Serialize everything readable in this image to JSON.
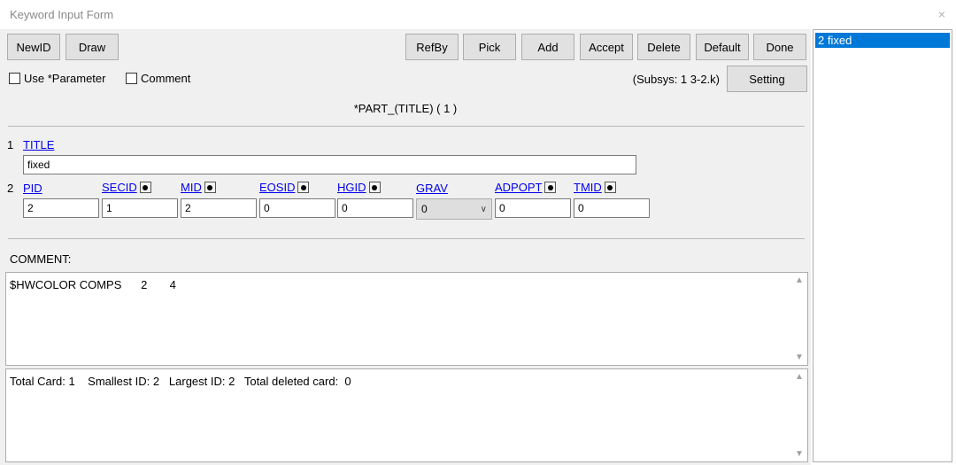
{
  "window": {
    "title": "Keyword Input Form",
    "close_glyph": "×"
  },
  "toolbar": {
    "newid": "NewID",
    "draw": "Draw",
    "refby": "RefBy",
    "pick": "Pick",
    "add": "Add",
    "accept": "Accept",
    "delete": "Delete",
    "default": "Default",
    "done": "Done",
    "setting": "Setting"
  },
  "options": {
    "use_parameter": "Use *Parameter",
    "comment": "Comment",
    "subsys": "(Subsys: 1 3-2.k)"
  },
  "keyword": {
    "title": "*PART_(TITLE)    ( 1 )"
  },
  "card1": {
    "num": "1",
    "title_label": "TITLE",
    "title_value": "fixed"
  },
  "card2": {
    "num": "2",
    "labels": {
      "pid": "PID",
      "secid": "SECID",
      "mid": "MID",
      "eosid": "EOSID",
      "hgid": "HGID",
      "grav": "GRAV",
      "adpopt": "ADPOPT",
      "tmid": "TMID"
    },
    "values": {
      "pid": "2",
      "secid": "1",
      "mid": "2",
      "eosid": "0",
      "hgid": "0",
      "grav": "0",
      "adpopt": "0",
      "tmid": "0"
    }
  },
  "comment": {
    "label": "COMMENT:",
    "text": "$HWCOLOR COMPS      2       4"
  },
  "status": {
    "text": "Total Card: 1    Smallest ID: 2   Largest ID: 2   Total deleted card:  0"
  },
  "list": {
    "items": [
      {
        "label": "2   fixed",
        "selected": true
      }
    ]
  },
  "icons": {
    "scroll_up": "▲",
    "scroll_down": "▼",
    "dropdown": "∨"
  }
}
